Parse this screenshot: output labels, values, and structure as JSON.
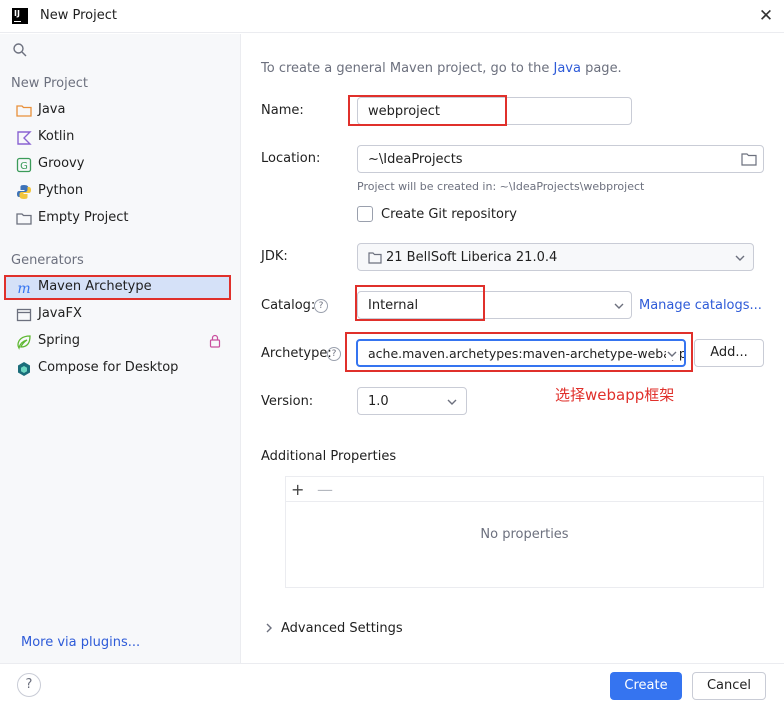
{
  "window": {
    "title": "New Project",
    "close_glyph": "✕"
  },
  "sidebar": {
    "new_project_header": "New Project",
    "new_project_items": [
      {
        "label": "Java",
        "icon": "java-folder-icon"
      },
      {
        "label": "Kotlin",
        "icon": "kotlin-icon"
      },
      {
        "label": "Groovy",
        "icon": "groovy-icon"
      },
      {
        "label": "Python",
        "icon": "python-icon"
      },
      {
        "label": "Empty Project",
        "icon": "empty-project-icon"
      }
    ],
    "generators_header": "Generators",
    "generator_items": [
      {
        "label": "Maven Archetype",
        "icon": "maven-icon",
        "selected": true
      },
      {
        "label": "JavaFX",
        "icon": "javafx-icon"
      },
      {
        "label": "Spring",
        "icon": "spring-icon",
        "locked": true
      },
      {
        "label": "Compose for Desktop",
        "icon": "compose-icon"
      }
    ],
    "more_plugins": "More via plugins..."
  },
  "main": {
    "intro_prefix": "To create a general Maven project, go to the",
    "intro_link": "Java",
    "intro_suffix": "page.",
    "name_label": "Name:",
    "name_value": "webproject",
    "location_label": "Location:",
    "location_value": "~\\IdeaProjects",
    "location_hint": "Project will be created in: ~\\IdeaProjects\\webproject",
    "git_label": "Create Git repository",
    "git_checked": false,
    "jdk_label": "JDK:",
    "jdk_value": "21 BellSoft Liberica 21.0.4",
    "catalog_label": "Catalog:",
    "catalog_value": "Internal",
    "manage_catalogs": "Manage catalogs...",
    "archetype_label": "Archetype:",
    "archetype_value": "ache.maven.archetypes:maven-archetype-webapp",
    "add_button": "Add...",
    "version_label": "Version:",
    "version_value": "1.0",
    "annotation": "选择webapp框架",
    "additional_properties": "Additional Properties",
    "add_glyph": "+",
    "remove_glyph": "—",
    "no_properties": "No properties",
    "advanced_settings": "Advanced Settings",
    "help_glyph": "?"
  },
  "footer": {
    "create": "Create",
    "cancel": "Cancel"
  },
  "colors": {
    "accent": "#3574f0",
    "annotation_red": "#e0302b",
    "selection": "#d5e1f8",
    "link": "#2e5bd8"
  }
}
